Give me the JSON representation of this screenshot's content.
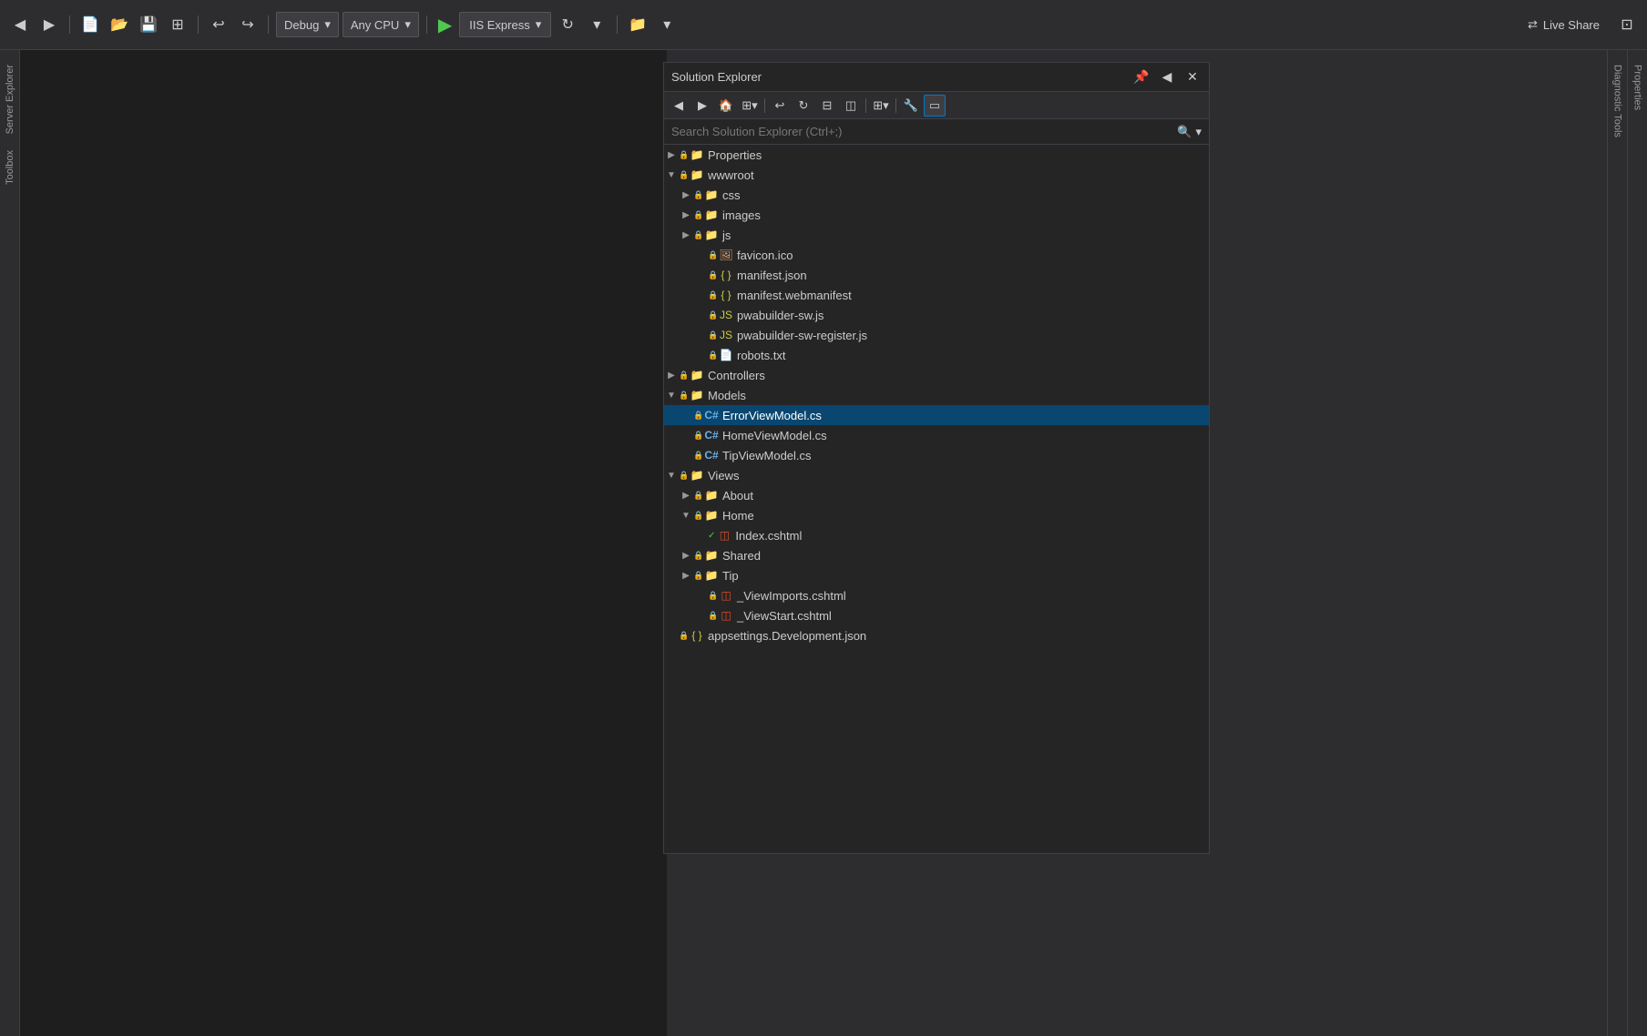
{
  "toolbar": {
    "debug_label": "Debug",
    "cpu_label": "Any CPU",
    "run_label": "▶",
    "iis_label": "IIS Express",
    "live_share_label": "Live Share",
    "buttons": [
      {
        "name": "new-project",
        "icon": "⊕"
      },
      {
        "name": "open",
        "icon": "📂"
      },
      {
        "name": "save",
        "icon": "💾"
      },
      {
        "name": "save-all",
        "icon": "⊞"
      },
      {
        "name": "undo",
        "icon": "↩"
      },
      {
        "name": "redo",
        "icon": "↪"
      }
    ]
  },
  "solution_explorer": {
    "title": "Solution Explorer",
    "search_placeholder": "Search Solution Explorer (Ctrl+;)",
    "tree": [
      {
        "id": "properties",
        "label": "Properties",
        "indent": 0,
        "expanded": false,
        "type": "folder",
        "has_lock": true
      },
      {
        "id": "wwwroot",
        "label": "wwwroot",
        "indent": 0,
        "expanded": true,
        "type": "folder",
        "has_lock": true
      },
      {
        "id": "css",
        "label": "css",
        "indent": 1,
        "expanded": false,
        "type": "folder",
        "has_lock": true
      },
      {
        "id": "images",
        "label": "images",
        "indent": 1,
        "expanded": false,
        "type": "folder",
        "has_lock": true
      },
      {
        "id": "js",
        "label": "js",
        "indent": 1,
        "expanded": false,
        "type": "folder",
        "has_lock": true
      },
      {
        "id": "favicon",
        "label": "favicon.ico",
        "indent": 2,
        "expanded": false,
        "type": "file-ico",
        "has_lock": true
      },
      {
        "id": "manifest-json",
        "label": "manifest.json",
        "indent": 2,
        "expanded": false,
        "type": "file-json",
        "has_lock": true
      },
      {
        "id": "manifest-web",
        "label": "manifest.webmanifest",
        "indent": 2,
        "expanded": false,
        "type": "file-json",
        "has_lock": true
      },
      {
        "id": "pwabuilder-sw",
        "label": "pwabuilder-sw.js",
        "indent": 2,
        "expanded": false,
        "type": "file-js",
        "has_lock": true
      },
      {
        "id": "pwabuilder-reg",
        "label": "pwabuilder-sw-register.js",
        "indent": 2,
        "expanded": false,
        "type": "file-js",
        "has_lock": true
      },
      {
        "id": "robots",
        "label": "robots.txt",
        "indent": 2,
        "expanded": false,
        "type": "file-txt",
        "has_lock": true
      },
      {
        "id": "controllers",
        "label": "Controllers",
        "indent": 0,
        "expanded": false,
        "type": "folder",
        "has_lock": true
      },
      {
        "id": "models",
        "label": "Models",
        "indent": 0,
        "expanded": true,
        "type": "folder",
        "has_lock": true
      },
      {
        "id": "errorviewmodel",
        "label": "ErrorViewModel.cs",
        "indent": 1,
        "expanded": false,
        "type": "file-cs",
        "has_lock": true,
        "selected": true
      },
      {
        "id": "homeviewmodel",
        "label": "HomeViewModel.cs",
        "indent": 1,
        "expanded": false,
        "type": "file-cs",
        "has_lock": true
      },
      {
        "id": "tipviewmodel",
        "label": "TipViewModel.cs",
        "indent": 1,
        "expanded": false,
        "type": "file-cs",
        "has_lock": true
      },
      {
        "id": "views",
        "label": "Views",
        "indent": 0,
        "expanded": true,
        "type": "folder",
        "has_lock": true
      },
      {
        "id": "about",
        "label": "About",
        "indent": 1,
        "expanded": false,
        "type": "folder",
        "has_lock": true
      },
      {
        "id": "home",
        "label": "Home",
        "indent": 1,
        "expanded": true,
        "type": "folder",
        "has_lock": true
      },
      {
        "id": "index-cshtml",
        "label": "Index.cshtml",
        "indent": 2,
        "expanded": false,
        "type": "file-html",
        "has_lock": false,
        "has_check": true
      },
      {
        "id": "shared",
        "label": "Shared",
        "indent": 1,
        "expanded": false,
        "type": "folder",
        "has_lock": true
      },
      {
        "id": "tip",
        "label": "Tip",
        "indent": 1,
        "expanded": false,
        "type": "folder",
        "has_lock": true
      },
      {
        "id": "viewimports",
        "label": "_ViewImports.cshtml",
        "indent": 2,
        "expanded": false,
        "type": "file-html",
        "has_lock": true
      },
      {
        "id": "viewstart",
        "label": "_ViewStart.cshtml",
        "indent": 2,
        "expanded": false,
        "type": "file-html",
        "has_lock": true
      },
      {
        "id": "appsettings-dev",
        "label": "appsettings.Development.json",
        "indent": 0,
        "expanded": false,
        "type": "file-json",
        "has_lock": true
      }
    ]
  },
  "left_sidebar": {
    "items": [
      {
        "label": "Server Explorer"
      },
      {
        "label": "Toolbox"
      }
    ]
  },
  "right_sidebar": {
    "items": [
      {
        "label": "Diagnostic Tools"
      },
      {
        "label": "Properties"
      }
    ]
  }
}
